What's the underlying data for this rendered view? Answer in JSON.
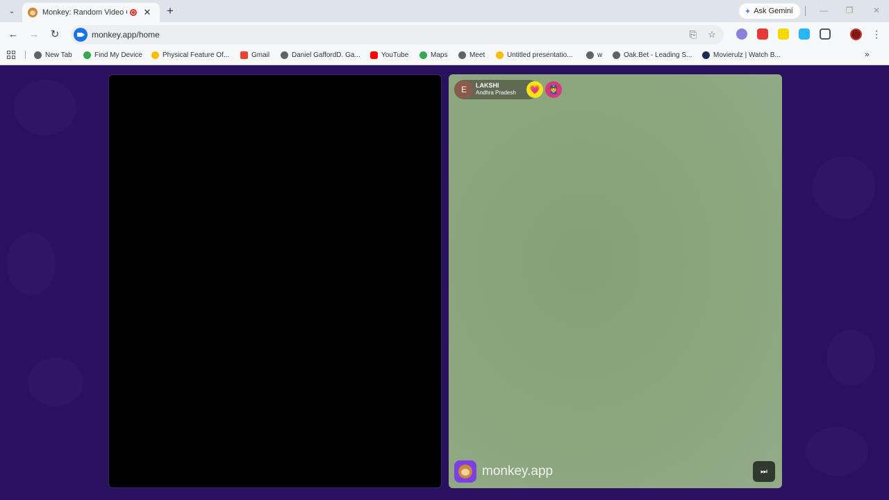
{
  "browser": {
    "tab": {
      "title": "Monkey: Random Video Chat",
      "close_label": "✕"
    },
    "new_tab_label": "+",
    "ask_gemini_label": "Ask Gemini",
    "window_controls": {
      "minimize": "—",
      "restore": "❐",
      "close": "✕"
    },
    "url": "monkey.app/home",
    "bookmarks": [
      {
        "label": "New Tab",
        "icon": "chrome-icon",
        "color": "#5f6368"
      },
      {
        "label": "Find My Device",
        "icon": "find-my-device-icon",
        "color": "#34a853"
      },
      {
        "label": "Physical Feature Of...",
        "icon": "drive-icon",
        "color": "#fbbc04"
      },
      {
        "label": "Gmail",
        "icon": "gmail-icon",
        "color": "#ea4335"
      },
      {
        "label": "Daniel GaffordD. Ga...",
        "icon": "globe-icon",
        "color": "#5f6368"
      },
      {
        "label": "YouTube",
        "icon": "youtube-icon",
        "color": "#ff0000"
      },
      {
        "label": "Maps",
        "icon": "maps-icon",
        "color": "#34a853"
      },
      {
        "label": "Meet",
        "icon": "globe-icon",
        "color": "#5f6368"
      },
      {
        "label": "Untitled presentatio...",
        "icon": "drive-icon",
        "color": "#fbbc04"
      },
      {
        "label": "w",
        "icon": "globe-icon",
        "color": "#5f6368"
      },
      {
        "label": "Oak.Bet - Leading S...",
        "icon": "globe-icon",
        "color": "#5f6368"
      },
      {
        "label": "Movierulz | Watch B...",
        "icon": "movierulz-icon",
        "color": "#1a2a55"
      }
    ],
    "more_bookmarks_label": "»"
  },
  "chat": {
    "partner": {
      "avatar_letter": "E",
      "name": "LAKSHI",
      "location": "Andhra Pradesh"
    },
    "heart_icon": "💗",
    "badge_icon": "👮",
    "brand_text": "monkey.app",
    "skip_icon": "⏭"
  },
  "colors": {
    "page_background": "#2a1160",
    "remote_video": "#8aa47b",
    "heart_button": "#f5e41c",
    "badge_button": "#d93a7a",
    "brand_logo": "#7b3fe4"
  }
}
